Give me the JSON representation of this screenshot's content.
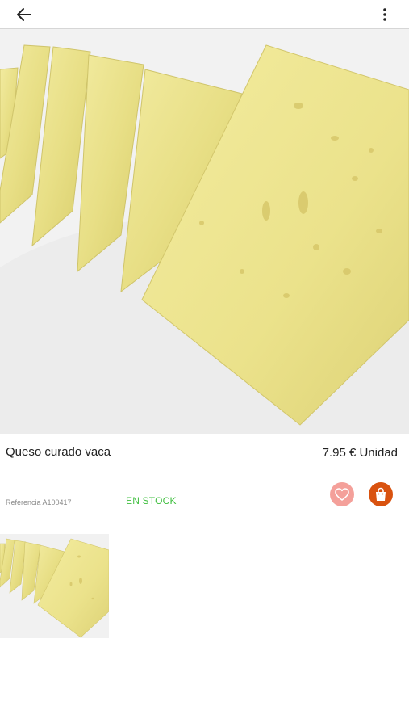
{
  "icons": {
    "back": "arrow-left-icon",
    "more": "more-vertical-icon",
    "favorite": "heart-icon",
    "cart": "shopping-bag-icon"
  },
  "product": {
    "name": "Queso curado vaca",
    "price": "7.95 € Unidad",
    "reference": "Referencia A100417",
    "stock_status": "EN STOCK"
  },
  "colors": {
    "stock_green": "#3fbf3f",
    "favorite_bg": "#f4a09a",
    "cart_bg": "#d9520f"
  }
}
